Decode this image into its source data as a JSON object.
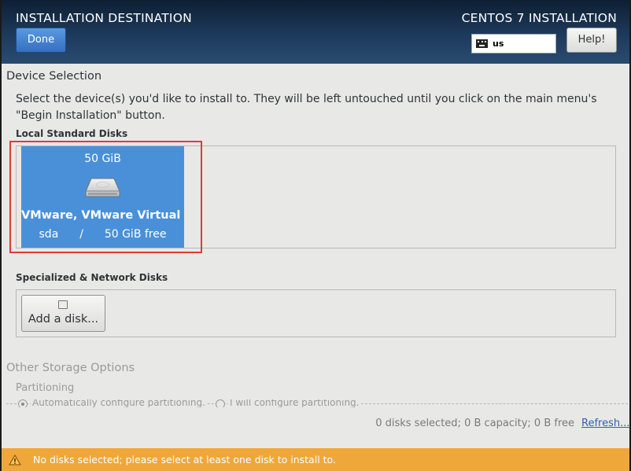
{
  "header": {
    "title": "INSTALLATION DESTINATION",
    "product": "CENTOS 7 INSTALLATION",
    "done_label": "Done",
    "help_label": "Help!",
    "keyboard_layout": "us"
  },
  "device_selection": {
    "heading": "Device Selection",
    "intro_line1": "Select the device(s) you'd like to install to.  They will be left untouched until you click on the main menu's",
    "intro_line2": "\"Begin Installation\" button.",
    "local_heading": "Local Standard Disks",
    "disks": [
      {
        "size": "50 GiB",
        "name": "VMware, VMware Virtual S",
        "device": "sda",
        "separator": "/",
        "free": "50 GiB free"
      }
    ],
    "specialized_heading": "Specialized & Network Disks",
    "add_disk_label": "Add a disk..."
  },
  "other_storage": {
    "heading": "Other Storage Options",
    "partitioning_label": "Partitioning",
    "auto_option": "Automatically configure partitioning.",
    "manual_option": "I will configure partitioning."
  },
  "summary": {
    "text": "0 disks selected; 0 B capacity; 0 B free",
    "refresh_label": "Refresh..."
  },
  "warning": {
    "text": "No disks selected; please select at least one disk to install to."
  },
  "colors": {
    "header": "#1d3a5c",
    "selected_disk": "#4a90d9",
    "warning_bar": "#f0a73a",
    "highlight": "#e03a3a"
  }
}
